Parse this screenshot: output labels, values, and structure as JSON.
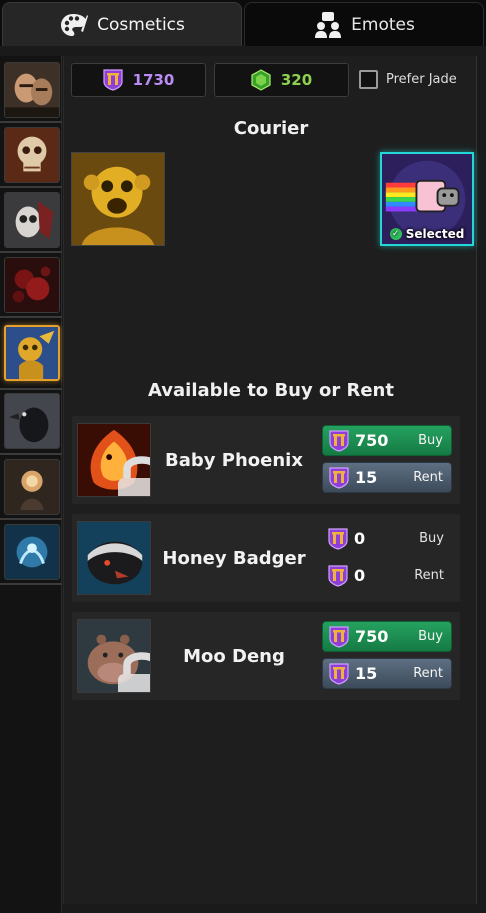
{
  "tabs": {
    "cosmetics": "Cosmetics",
    "emotes": "Emotes"
  },
  "sidebar": {
    "items": [
      {
        "icon": "hero-portrait-icon"
      },
      {
        "icon": "skull-icon"
      },
      {
        "icon": "masked-figure-icon"
      },
      {
        "icon": "blood-splatter-icon"
      },
      {
        "icon": "golden-monkey-icon",
        "selected": true
      },
      {
        "icon": "raven-icon"
      },
      {
        "icon": "orb-icon"
      },
      {
        "icon": "spirit-icon"
      }
    ]
  },
  "currency": {
    "gold": "1730",
    "jade": "320",
    "prefer_jade": "Prefer Jade",
    "gold_color": "#b98cf2",
    "jade_color": "#8fd14f"
  },
  "courier": {
    "title": "Courier",
    "selected_label": "Selected",
    "current_icon": "golden-monkey-icon",
    "selected_icon": "rainbow-cat-icon"
  },
  "shop": {
    "title": "Available to Buy or Rent",
    "items": [
      {
        "name": "Baby Phoenix",
        "buy_price": "750",
        "buy_label": "Buy",
        "rent_price": "15",
        "rent_label": "Rent",
        "icon": "phoenix-icon",
        "locked": true
      },
      {
        "name": "Honey Badger",
        "buy_price": "0",
        "buy_label": "Buy",
        "rent_price": "0",
        "rent_label": "Rent",
        "icon": "honey-badger-icon",
        "locked": false
      },
      {
        "name": "Moo Deng",
        "buy_price": "750",
        "buy_label": "Buy",
        "rent_price": "15",
        "rent_label": "Rent",
        "icon": "hippo-icon",
        "locked": true
      }
    ]
  },
  "colors": {
    "selected_border": "#22d7d7",
    "sidebar_selected": "#e7a02b",
    "buy_button": "#1f8f52",
    "rent_button": "#4c5c6d"
  }
}
